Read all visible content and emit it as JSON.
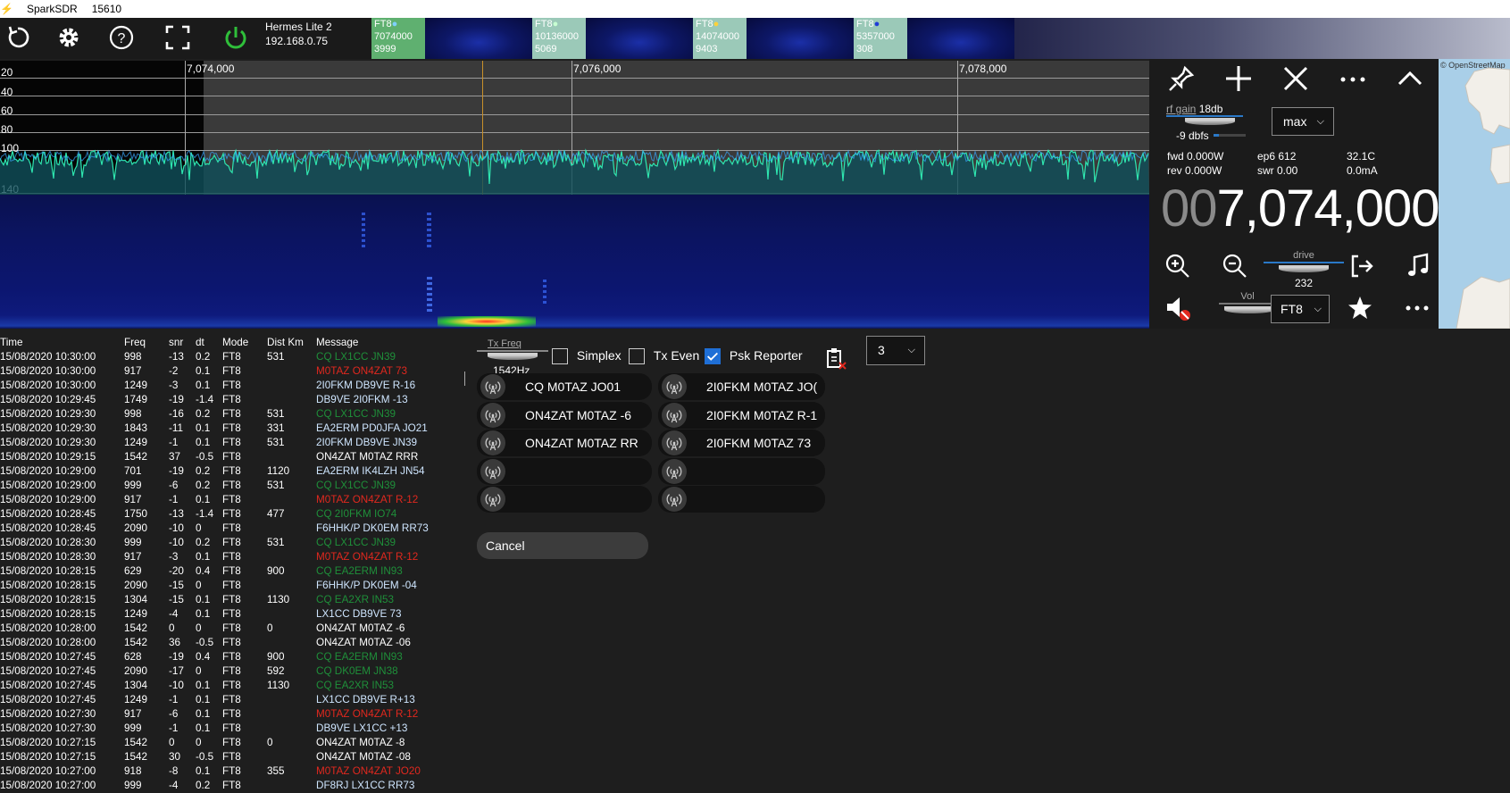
{
  "window": {
    "app": "SparkSDR",
    "pid": "15610"
  },
  "radio": {
    "name": "Hermes Lite 2",
    "ip": "192.168.0.75"
  },
  "bands": [
    {
      "mode": "FT8",
      "freq": "7074000",
      "count": "3999",
      "dot_color": "#7fd0ff"
    },
    {
      "mode": "FT8",
      "freq": "10136000",
      "count": "5069",
      "dot_color": "#c7ffd2"
    },
    {
      "mode": "FT8",
      "freq": "14074000",
      "count": "9403",
      "dot_color": "#ffd23a"
    },
    {
      "mode": "FT8",
      "freq": "5357000",
      "count": "308",
      "dot_color": "#1f3bd8"
    }
  ],
  "spectrum": {
    "db_labels": [
      "20",
      "40",
      "60",
      "80",
      "100",
      "140"
    ],
    "freq_labels": [
      "7,074,000",
      "7,076,000",
      "7,078,000"
    ]
  },
  "control": {
    "rf_gain_label": "rf gain",
    "rf_gain_value": "18db",
    "dbfs": "-9 dbfs",
    "agc_select": "max",
    "fwd": "fwd 0.000W",
    "rev": "rev 0.000W",
    "ep6": "ep6 612",
    "swr": "swr 0.00",
    "temp": "32.1C",
    "current": "0.0mA",
    "freq_dim": "00",
    "freq_main": "7,074,000",
    "drive_label": "drive",
    "drive_value": "232",
    "vol_label": "Vol",
    "mode_select": "FT8"
  },
  "map": {
    "attribution": "© OpenStreetMap"
  },
  "log": {
    "headers": {
      "time": "Time",
      "freq": "Freq",
      "snr": "snr",
      "dt": "dt",
      "mode": "Mode",
      "dist": "Dist Km",
      "message": "Message"
    },
    "rows": [
      {
        "time": "15/08/2020 10:30:00",
        "freq": "998",
        "snr": "-13",
        "dt": "0.2",
        "mode": "FT8",
        "dist": "531",
        "message": "CQ LX1CC JN39",
        "kind": "cq"
      },
      {
        "time": "15/08/2020 10:30:00",
        "freq": "917",
        "snr": "-2",
        "dt": "0.1",
        "mode": "FT8",
        "dist": "",
        "message": "M0TAZ ON4ZAT 73",
        "kind": "red"
      },
      {
        "time": "15/08/2020 10:30:00",
        "freq": "1249",
        "snr": "-3",
        "dt": "0.1",
        "mode": "FT8",
        "dist": "",
        "message": "2I0FKM DB9VE R-16",
        "kind": "blue"
      },
      {
        "time": "15/08/2020 10:29:45",
        "freq": "1749",
        "snr": "-19",
        "dt": "-1.4",
        "mode": "FT8",
        "dist": "",
        "message": "DB9VE 2I0FKM -13",
        "kind": "blue"
      },
      {
        "time": "15/08/2020 10:29:30",
        "freq": "998",
        "snr": "-16",
        "dt": "0.2",
        "mode": "FT8",
        "dist": "531",
        "message": "CQ LX1CC JN39",
        "kind": "cq"
      },
      {
        "time": "15/08/2020 10:29:30",
        "freq": "1843",
        "snr": "-11",
        "dt": "0.1",
        "mode": "FT8",
        "dist": "331",
        "message": "EA2ERM PD0JFA JO21",
        "kind": "blue"
      },
      {
        "time": "15/08/2020 10:29:30",
        "freq": "1249",
        "snr": "-1",
        "dt": "0.1",
        "mode": "FT8",
        "dist": "531",
        "message": "2I0FKM DB9VE JN39",
        "kind": "blue"
      },
      {
        "time": "15/08/2020 10:29:15",
        "freq": "1542",
        "snr": "37",
        "dt": "-0.5",
        "mode": "FT8",
        "dist": "",
        "message": "ON4ZAT M0TAZ RRR",
        "kind": "white"
      },
      {
        "time": "15/08/2020 10:29:00",
        "freq": "701",
        "snr": "-19",
        "dt": "0.2",
        "mode": "FT8",
        "dist": "1120",
        "message": "EA2ERM IK4LZH JN54",
        "kind": "blue"
      },
      {
        "time": "15/08/2020 10:29:00",
        "freq": "999",
        "snr": "-6",
        "dt": "0.2",
        "mode": "FT8",
        "dist": "531",
        "message": "CQ LX1CC JN39",
        "kind": "cq"
      },
      {
        "time": "15/08/2020 10:29:00",
        "freq": "917",
        "snr": "-1",
        "dt": "0.1",
        "mode": "FT8",
        "dist": "",
        "message": "M0TAZ ON4ZAT R-12",
        "kind": "red"
      },
      {
        "time": "15/08/2020 10:28:45",
        "freq": "1750",
        "snr": "-13",
        "dt": "-1.4",
        "mode": "FT8",
        "dist": "477",
        "message": "CQ 2I0FKM IO74",
        "kind": "cq"
      },
      {
        "time": "15/08/2020 10:28:45",
        "freq": "2090",
        "snr": "-10",
        "dt": "0",
        "mode": "FT8",
        "dist": "",
        "message": "F6HHK/P DK0EM RR73",
        "kind": "blue"
      },
      {
        "time": "15/08/2020 10:28:30",
        "freq": "999",
        "snr": "-10",
        "dt": "0.2",
        "mode": "FT8",
        "dist": "531",
        "message": "CQ LX1CC JN39",
        "kind": "cq"
      },
      {
        "time": "15/08/2020 10:28:30",
        "freq": "917",
        "snr": "-3",
        "dt": "0.1",
        "mode": "FT8",
        "dist": "",
        "message": "M0TAZ ON4ZAT R-12",
        "kind": "red"
      },
      {
        "time": "15/08/2020 10:28:15",
        "freq": "629",
        "snr": "-20",
        "dt": "0.4",
        "mode": "FT8",
        "dist": "900",
        "message": "CQ EA2ERM IN93",
        "kind": "cq"
      },
      {
        "time": "15/08/2020 10:28:15",
        "freq": "2090",
        "snr": "-15",
        "dt": "0",
        "mode": "FT8",
        "dist": "",
        "message": "F6HHK/P DK0EM -04",
        "kind": "blue"
      },
      {
        "time": "15/08/2020 10:28:15",
        "freq": "1304",
        "snr": "-15",
        "dt": "0.1",
        "mode": "FT8",
        "dist": "1130",
        "message": "CQ EA2XR IN53",
        "kind": "cq"
      },
      {
        "time": "15/08/2020 10:28:15",
        "freq": "1249",
        "snr": "-4",
        "dt": "0.1",
        "mode": "FT8",
        "dist": "",
        "message": "LX1CC DB9VE 73",
        "kind": "blue"
      },
      {
        "time": "15/08/2020 10:28:00",
        "freq": "1542",
        "snr": "0",
        "dt": "0",
        "mode": "FT8",
        "dist": "0",
        "message": "ON4ZAT M0TAZ -6",
        "kind": "white"
      },
      {
        "time": "15/08/2020 10:28:00",
        "freq": "1542",
        "snr": "36",
        "dt": "-0.5",
        "mode": "FT8",
        "dist": "",
        "message": "ON4ZAT M0TAZ -06",
        "kind": "white"
      },
      {
        "time": "15/08/2020 10:27:45",
        "freq": "628",
        "snr": "-19",
        "dt": "0.4",
        "mode": "FT8",
        "dist": "900",
        "message": "CQ EA2ERM IN93",
        "kind": "cq"
      },
      {
        "time": "15/08/2020 10:27:45",
        "freq": "2090",
        "snr": "-17",
        "dt": "0",
        "mode": "FT8",
        "dist": "592",
        "message": "CQ DK0EM JN38",
        "kind": "cq"
      },
      {
        "time": "15/08/2020 10:27:45",
        "freq": "1304",
        "snr": "-10",
        "dt": "0.1",
        "mode": "FT8",
        "dist": "1130",
        "message": "CQ EA2XR IN53",
        "kind": "cq"
      },
      {
        "time": "15/08/2020 10:27:45",
        "freq": "1249",
        "snr": "-1",
        "dt": "0.1",
        "mode": "FT8",
        "dist": "",
        "message": "LX1CC DB9VE R+13",
        "kind": "blue"
      },
      {
        "time": "15/08/2020 10:27:30",
        "freq": "917",
        "snr": "-6",
        "dt": "0.1",
        "mode": "FT8",
        "dist": "",
        "message": "M0TAZ ON4ZAT R-12",
        "kind": "red"
      },
      {
        "time": "15/08/2020 10:27:30",
        "freq": "999",
        "snr": "-1",
        "dt": "0.1",
        "mode": "FT8",
        "dist": "",
        "message": "DB9VE LX1CC +13",
        "kind": "blue"
      },
      {
        "time": "15/08/2020 10:27:15",
        "freq": "1542",
        "snr": "0",
        "dt": "0",
        "mode": "FT8",
        "dist": "0",
        "message": "ON4ZAT M0TAZ -8",
        "kind": "white"
      },
      {
        "time": "15/08/2020 10:27:15",
        "freq": "1542",
        "snr": "30",
        "dt": "-0.5",
        "mode": "FT8",
        "dist": "",
        "message": "ON4ZAT M0TAZ -08",
        "kind": "white"
      },
      {
        "time": "15/08/2020 10:27:00",
        "freq": "918",
        "snr": "-8",
        "dt": "0.1",
        "mode": "FT8",
        "dist": "355",
        "message": "M0TAZ ON4ZAT JO20",
        "kind": "red"
      },
      {
        "time": "15/08/2020 10:27:00",
        "freq": "999",
        "snr": "-4",
        "dt": "0.2",
        "mode": "FT8",
        "dist": "",
        "message": "DF8RJ LX1CC RR73",
        "kind": "blue"
      }
    ]
  },
  "tx": {
    "txfreq_label": "Tx Freq",
    "txfreq_value": "1542Hz",
    "simplex": "Simplex",
    "tx_even": "Tx Even",
    "psk_reporter": "Psk Reporter",
    "simplex_checked": false,
    "tx_even_checked": false,
    "psk_checked": true,
    "cycles_select": "3",
    "messages_left": [
      "CQ M0TAZ JO01",
      "ON4ZAT M0TAZ -6",
      "ON4ZAT M0TAZ RR",
      "",
      ""
    ],
    "messages_right": [
      "2I0FKM M0TAZ JO(",
      "2I0FKM M0TAZ R-1",
      "2I0FKM M0TAZ 73",
      "",
      ""
    ],
    "cancel": "Cancel"
  }
}
